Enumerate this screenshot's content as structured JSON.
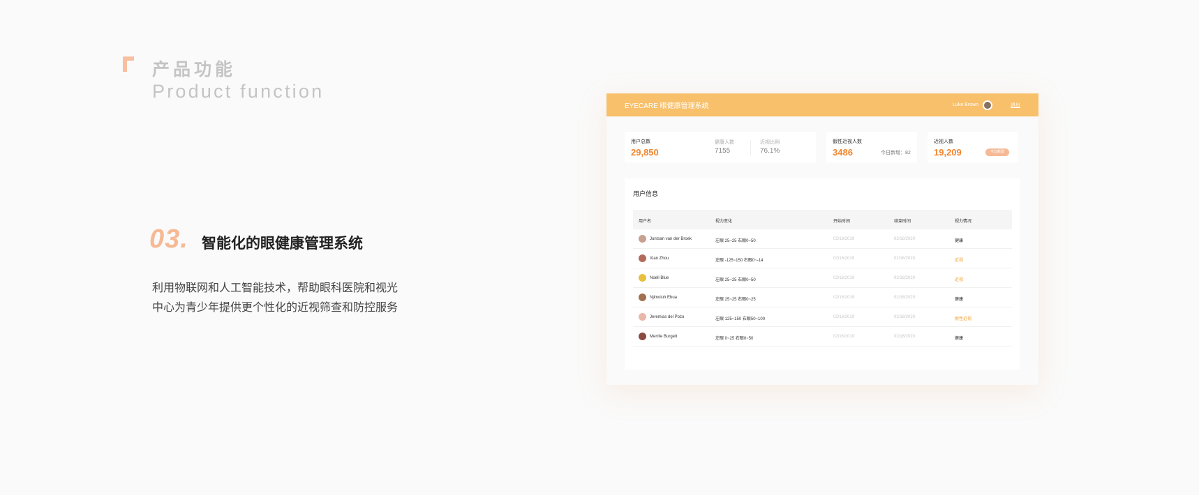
{
  "heading": {
    "title_cn": "产品功能",
    "title_en": "Product function"
  },
  "feature": {
    "number": "03.",
    "title": "智能化的眼健康管理系统",
    "desc_line1": "利用物联网和人工智能技术，帮助眼科医院和视光",
    "desc_line2": "中心为青少年提供更个性化的近视筛查和防控服务"
  },
  "app": {
    "brand": "EYECARE 眼健康管理系统",
    "user_name": "Luke Brown",
    "logout": "退出",
    "accent": "#f8c06a",
    "stats": {
      "total_label": "用户总数",
      "total_value": "29,850",
      "healthy_label": "健康人数",
      "healthy_value": "7155",
      "myopia_ratio_label": "近视比例",
      "myopia_ratio_value": "76.1%",
      "pseudo_label": "假性近视人数",
      "pseudo_value": "3486",
      "pseudo_note": "今日新增：82",
      "myopia_label": "近视人数",
      "myopia_value": "19,209",
      "myopia_pill": "今日新增"
    },
    "table": {
      "title": "用户信息",
      "headers": [
        "用户名",
        "视力变化",
        "开始时间",
        "结束时间",
        "视力情况"
      ],
      "rows": [
        {
          "name": "Juntsan van der Broek",
          "vision": "左眼  25~25   右眼0~50",
          "start": "02/16/2019",
          "end": "02/16/2020",
          "status": "健康",
          "avatar_color": "#c8a090"
        },
        {
          "name": "Xian Zhou",
          "vision": "左眼  -125~150   右眼0~-14",
          "start": "02/16/2019",
          "end": "02/16/2020",
          "status": "近视",
          "avatar_color": "#b46a5a"
        },
        {
          "name": "Noell Blue",
          "vision": "左眼  25~25   右眼0~50",
          "start": "02/16/2019",
          "end": "02/16/2020",
          "status": "近视",
          "avatar_color": "#e8c040"
        },
        {
          "name": "Njimoluh Ebua",
          "vision": "左眼  25~25   右眼0~25",
          "start": "02/16/2019",
          "end": "02/16/2020",
          "status": "健康",
          "avatar_color": "#a07050"
        },
        {
          "name": "Jeremias del Pozo",
          "vision": "左眼  125~150   右眼50~100",
          "start": "02/16/2019",
          "end": "02/16/2020",
          "status": "假性近视",
          "avatar_color": "#e8b8a8"
        },
        {
          "name": "Merrile Burgett",
          "vision": "左眼  0~25   右眼0~50",
          "start": "02/16/2019",
          "end": "02/16/2020",
          "status": "健康",
          "avatar_color": "#8a4a40"
        }
      ]
    }
  }
}
